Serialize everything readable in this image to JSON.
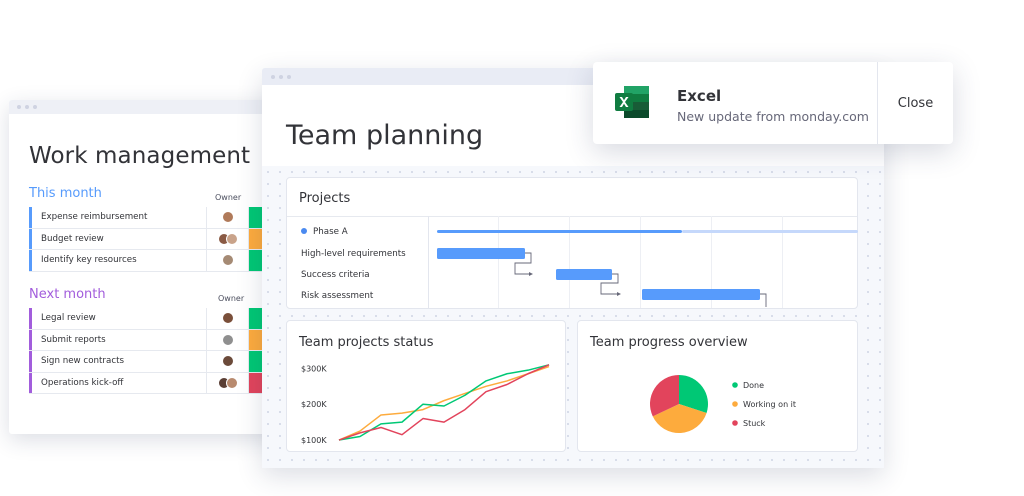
{
  "work_management": {
    "title": "Work management",
    "groups": [
      {
        "title": "This month",
        "owner_label": "Owner",
        "color": "#579bfc",
        "rows": [
          {
            "label": "Expense reimbursement",
            "status_color": "#00c875",
            "avatars": [
              "#b07a5a"
            ]
          },
          {
            "label": "Budget review",
            "status_color": "#fdab3d",
            "avatars": [
              "#8a5a44",
              "#c9a38a"
            ]
          },
          {
            "label": "Identify key resources",
            "status_color": "#00c875",
            "avatars": [
              "#a58a74"
            ]
          }
        ]
      },
      {
        "title": "Next month",
        "owner_label": "Owner",
        "color": "#a25ddc",
        "rows": [
          {
            "label": "Legal review",
            "status_color": "#00c875",
            "avatars": [
              "#7a4f3a"
            ]
          },
          {
            "label": "Submit reports",
            "status_color": "#fdab3d",
            "avatars": [
              "#8f8f8f"
            ]
          },
          {
            "label": "Sign new contracts",
            "status_color": "#00c875",
            "avatars": [
              "#6b4a3a"
            ]
          },
          {
            "label": "Operations kick-off",
            "status_color": "#e2445c",
            "avatars": [
              "#5a3e34",
              "#b88a6e"
            ]
          }
        ]
      }
    ]
  },
  "team_planning": {
    "title": "Team planning",
    "projects": {
      "title": "Projects",
      "phase": "Phase A",
      "tasks": [
        "High-level requirements",
        "Success criteria",
        "Risk assessment"
      ]
    },
    "status_card": {
      "title": "Team projects status"
    },
    "progress_card": {
      "title": "Team progress overview"
    }
  },
  "notification": {
    "app": "Excel",
    "message": "New update from monday.com",
    "close_label": "Close",
    "icon": "excel-logo-icon"
  },
  "chart_data": [
    {
      "type": "line",
      "title": "Team projects status",
      "y_tick_labels": [
        "$300K",
        "$200K",
        "$100K"
      ],
      "ylim": [
        75,
        315
      ],
      "x": [
        0,
        1,
        2,
        3,
        4,
        5,
        6,
        7,
        8,
        9,
        10
      ],
      "series": [
        {
          "color": "#fdab3d",
          "values": [
            100,
            125,
            170,
            175,
            185,
            210,
            230,
            250,
            265,
            285,
            305
          ]
        },
        {
          "color": "#00c875",
          "values": [
            100,
            110,
            145,
            150,
            200,
            195,
            225,
            265,
            285,
            295,
            310
          ]
        },
        {
          "color": "#e2445c",
          "values": [
            100,
            120,
            135,
            115,
            160,
            150,
            185,
            235,
            255,
            285,
            310
          ]
        }
      ],
      "grid": false
    },
    {
      "type": "pie",
      "title": "Team progress overview",
      "categories": [
        "Done",
        "Working on it",
        "Stuck"
      ],
      "values": [
        30,
        38,
        32
      ],
      "colors": [
        "#00c875",
        "#fdab3d",
        "#e2445c"
      ],
      "legend": "right"
    }
  ]
}
